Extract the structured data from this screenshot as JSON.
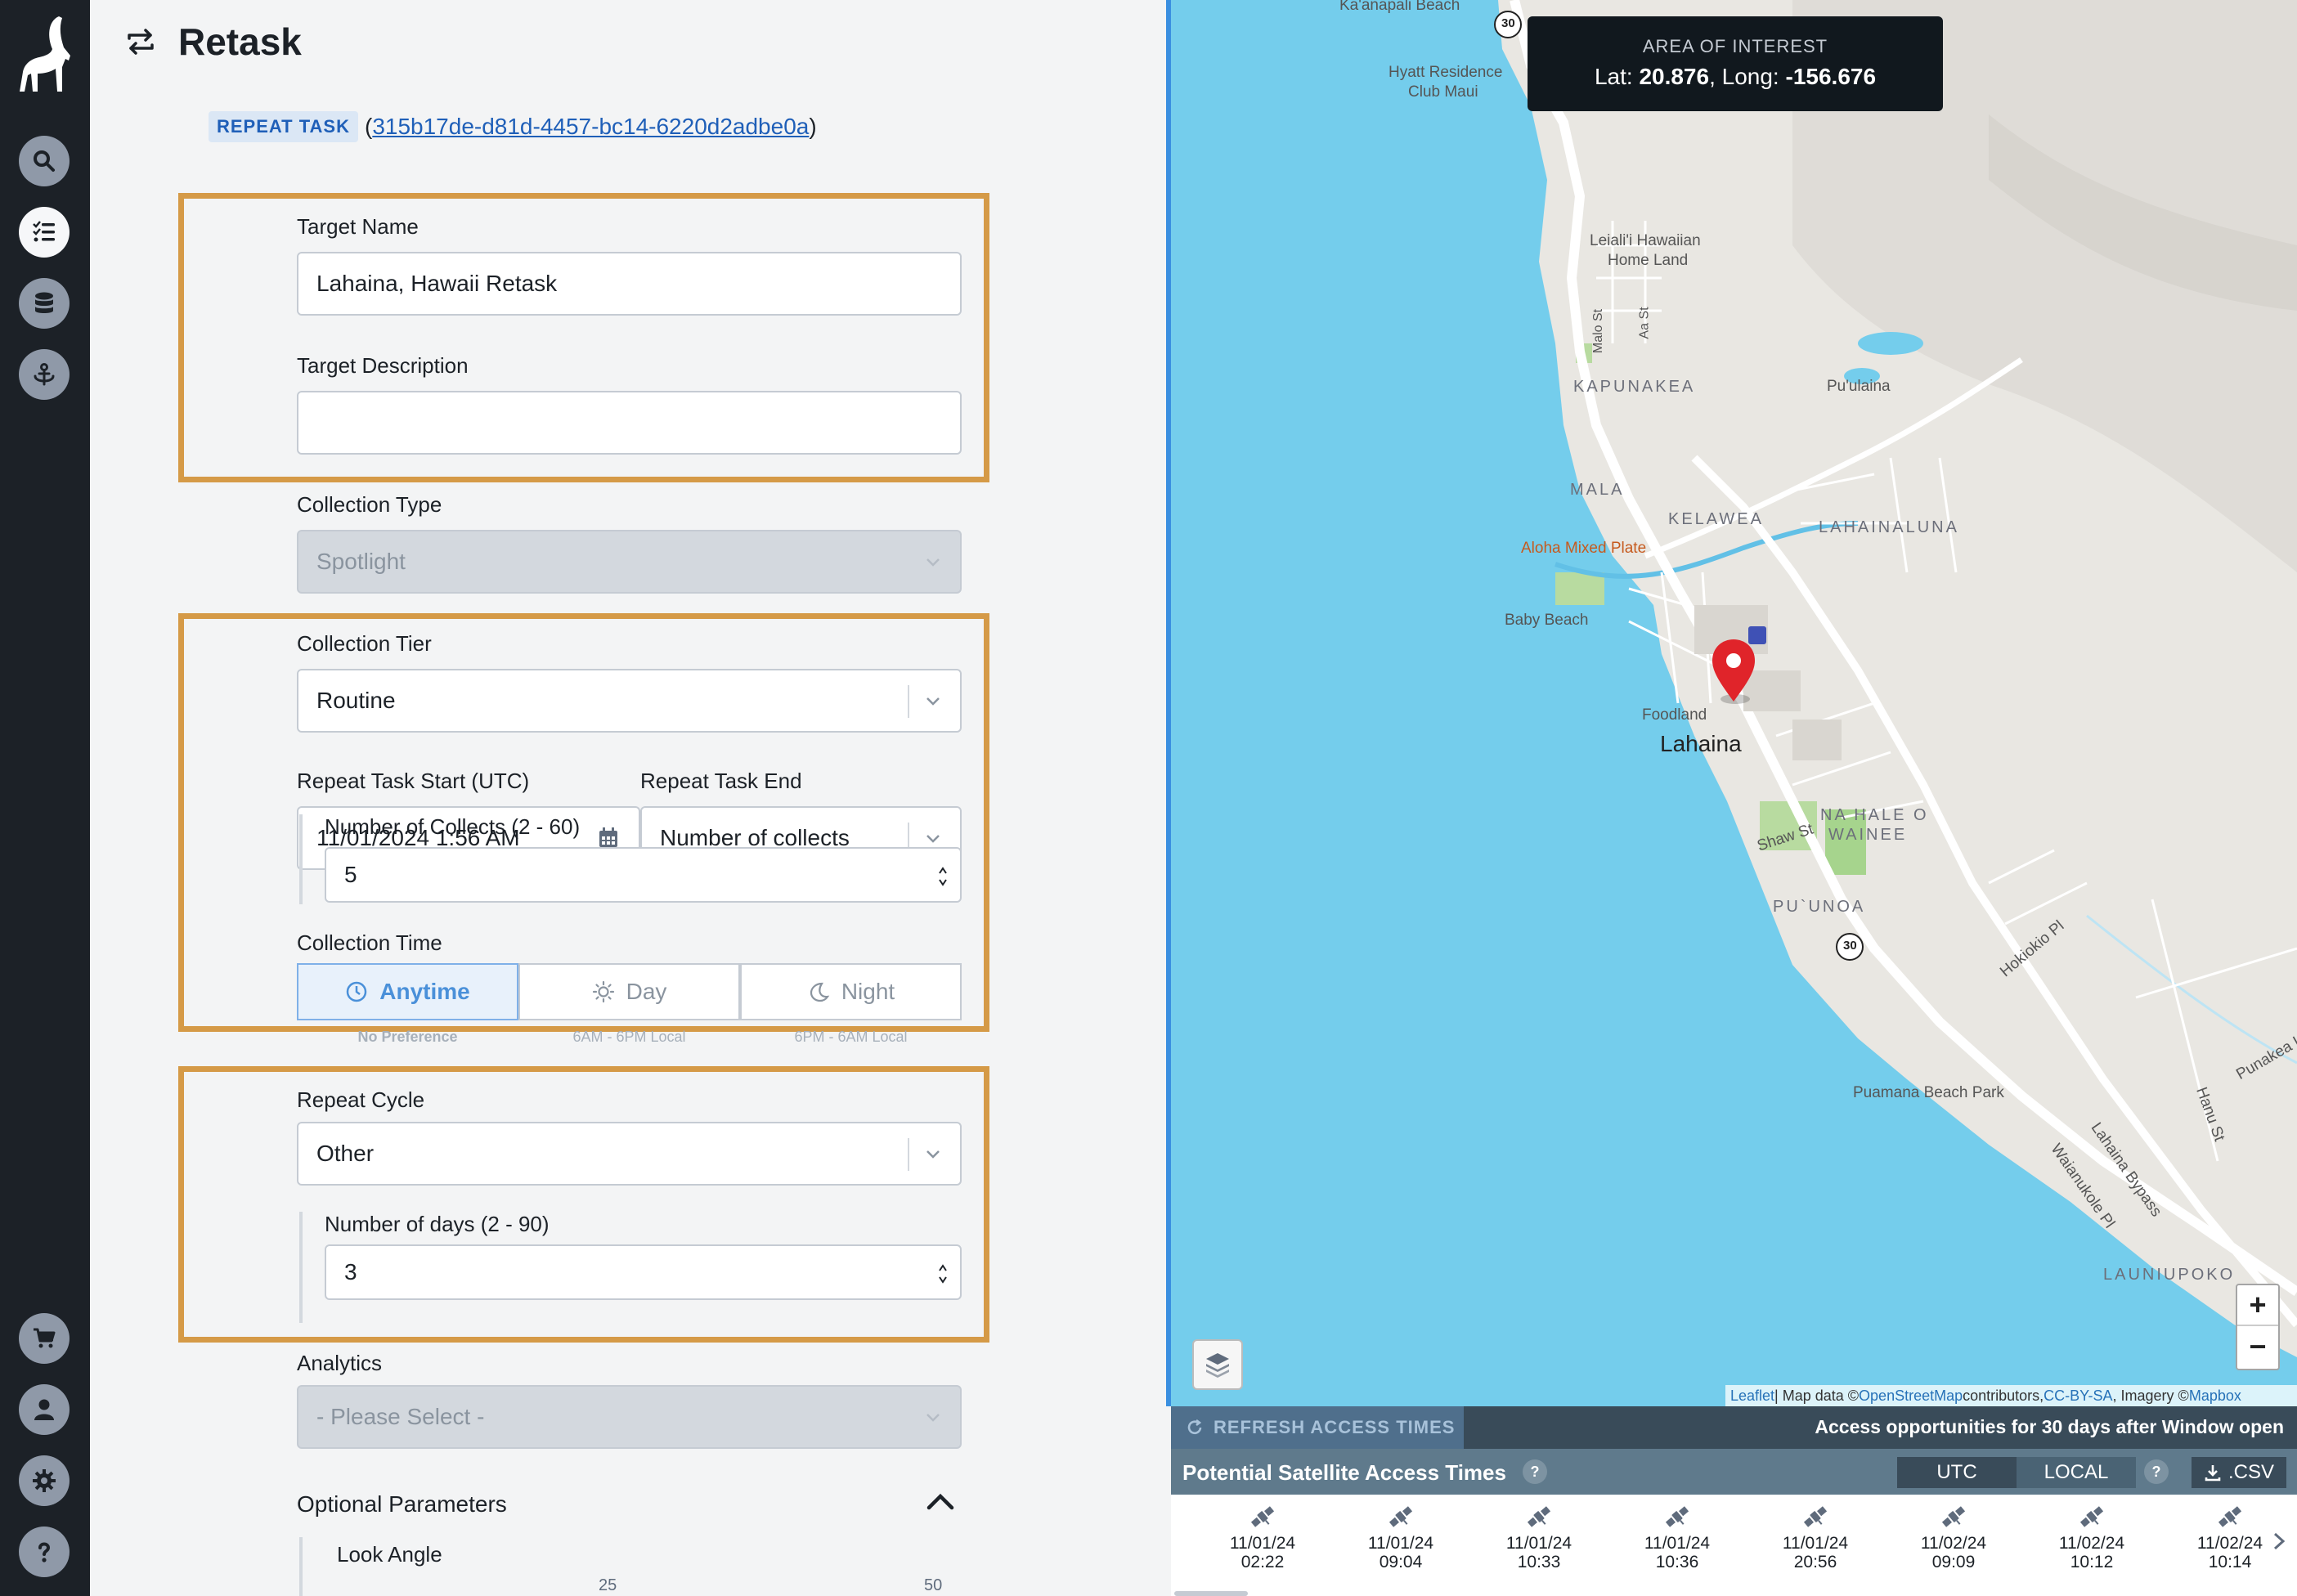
{
  "app": {
    "page_title": "Retask"
  },
  "sidebar": {
    "items": [
      {
        "name": "search",
        "icon": "search-icon"
      },
      {
        "name": "tasks",
        "icon": "task-list-icon",
        "active": true
      },
      {
        "name": "data",
        "icon": "database-icon"
      },
      {
        "name": "anchor",
        "icon": "anchor-icon"
      }
    ],
    "bottom": [
      {
        "name": "cart",
        "icon": "cart-icon"
      },
      {
        "name": "profile",
        "icon": "user-icon"
      },
      {
        "name": "settings",
        "icon": "gear-icon"
      },
      {
        "name": "help",
        "icon": "help-icon"
      }
    ]
  },
  "task": {
    "badge": "REPEAT TASK",
    "open_paren": "(",
    "id": "315b17de-d81d-4457-bc14-6220d2adbe0a",
    "close_paren": ")"
  },
  "form": {
    "target_name_label": "Target Name",
    "target_name_value": "Lahaina, Hawaii Retask",
    "target_description_label": "Target Description",
    "target_description_value": "",
    "collection_type_label": "Collection Type",
    "collection_type_value": "Spotlight",
    "collection_tier_label": "Collection Tier",
    "collection_tier_value": "Routine",
    "repeat_start_label": "Repeat Task Start (UTC)",
    "repeat_start_value": "11/01/2024 1:56 AM",
    "repeat_end_label": "Repeat Task End",
    "repeat_end_value": "Number of collects",
    "num_collects_label": "Number of Collects (2 - 60)",
    "num_collects_value": "5",
    "collection_time_label": "Collection Time",
    "collection_time_options": [
      {
        "label": "Anytime",
        "hint": "No Preference",
        "selected": true
      },
      {
        "label": "Day",
        "hint": "6AM - 6PM Local",
        "selected": false
      },
      {
        "label": "Night",
        "hint": "6PM - 6AM Local",
        "selected": false
      }
    ],
    "repeat_cycle_label": "Repeat Cycle",
    "repeat_cycle_value": "Other",
    "num_days_label": "Number of days (2 - 90)",
    "num_days_value": "3",
    "analytics_label": "Analytics",
    "analytics_value": "- Please Select -",
    "optional_params_label": "Optional Parameters",
    "look_angle_label": "Look Angle",
    "look_angle_ticks": [
      "25",
      "50"
    ]
  },
  "map": {
    "aoi_title": "AREA OF INTEREST",
    "aoi_lat_label": "Lat:",
    "aoi_lat": "20.876",
    "aoi_long_label": "Long:",
    "aoi_long": "-156.676",
    "zoom_in": "+",
    "zoom_out": "−",
    "attribution": {
      "leaflet": "Leaflet",
      "sep": " | Map data © ",
      "osm": "OpenStreetMap",
      "contributors": " contributors, ",
      "license": "CC-BY-SA",
      "imagery": ", Imagery © ",
      "mapbox": "Mapbox"
    },
    "labels": {
      "kaanapali_beach": "Ka'anapali Beach",
      "hyatt": "Hyatt Residence",
      "club_maui": "Club Maui",
      "leialii": "Leiali'i Hawaiian",
      "home_land": "Home Land",
      "malo_st": "Malo St",
      "aa_st": "Aa St",
      "puulaina": "Pu'ulaina",
      "kapunakea": "KAPUNAKEA",
      "mala": "MALA",
      "kelawea": "KELAWEA",
      "lahainaluna": "LAHAINALUNA",
      "aloha_mixed_plate": "Aloha Mixed Plate",
      "baby_beach": "Baby Beach",
      "foodland": "Foodland",
      "lahaina": "Lahaina",
      "na_hale_o": "NA HALE O",
      "wainee": "WAINEE",
      "shaw_st": "Shaw St",
      "puunoa": "PU`UNOA",
      "hokiokio_pl": "Hokiokio Pl",
      "puamana": "Puamana Beach Park",
      "punakea_lp": "Punakea Lp",
      "hanu_st": "Hanu St",
      "lahaina_bypass": "Lahaina Bypass",
      "waianukole_pl": "Waianukole Pl",
      "launiupoko": "LAUNIUPOKO",
      "route_30": "30"
    }
  },
  "access": {
    "refresh_label": "REFRESH ACCESS TIMES",
    "note": "Access opportunities for 30 days after Window open",
    "title": "Potential Satellite Access Times",
    "help": "?",
    "utc_label": "UTC",
    "local_label": "LOCAL",
    "csv_label": ".CSV",
    "items": [
      {
        "date": "11/01/24",
        "time": "02:22"
      },
      {
        "date": "11/01/24",
        "time": "09:04"
      },
      {
        "date": "11/01/24",
        "time": "10:33"
      },
      {
        "date": "11/01/24",
        "time": "10:36"
      },
      {
        "date": "11/01/24",
        "time": "20:56"
      },
      {
        "date": "11/02/24",
        "time": "09:09"
      },
      {
        "date": "11/02/24",
        "time": "10:12"
      },
      {
        "date": "11/02/24",
        "time": "10:14"
      }
    ]
  },
  "colors": {
    "highlight_border": "#d59a47",
    "sidebar_bg": "#1c2127",
    "link_blue": "#1f5fb8",
    "water": "#74cdec",
    "marker_red": "#e0242a"
  }
}
